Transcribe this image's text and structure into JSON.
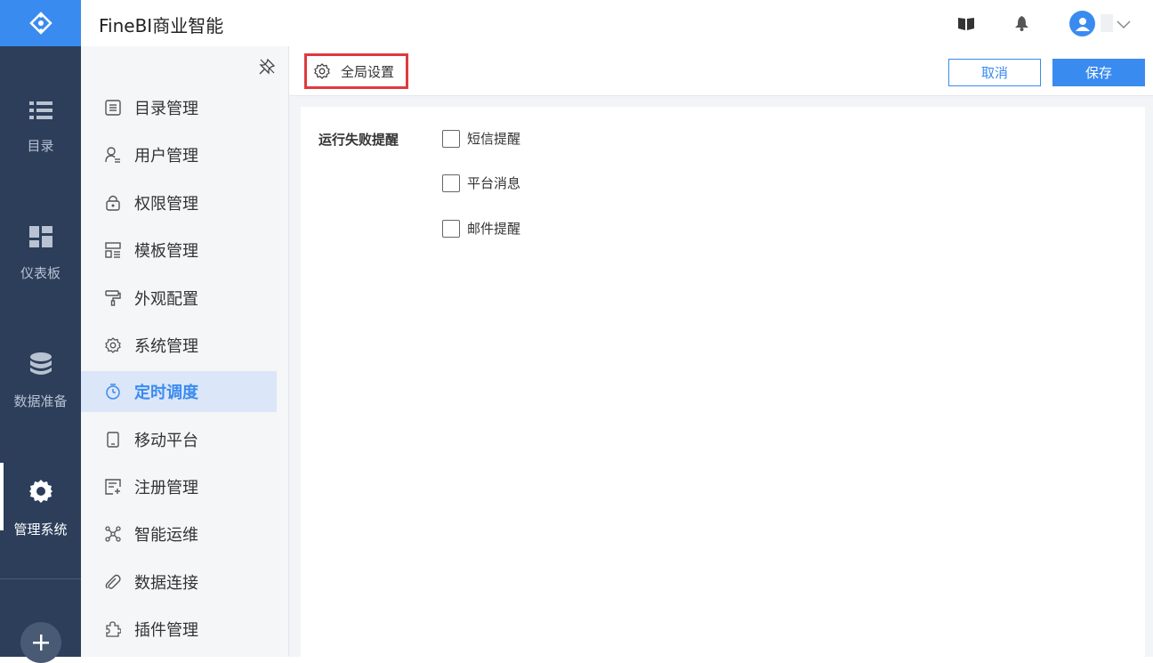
{
  "app": {
    "title": "FineBI商业智能"
  },
  "rail": {
    "items": [
      {
        "label": "目录",
        "icon": "list-icon"
      },
      {
        "label": "仪表板",
        "icon": "dashboard-icon"
      },
      {
        "label": "数据准备",
        "icon": "database-icon"
      },
      {
        "label": "管理系统",
        "icon": "gear-icon",
        "active": true
      }
    ],
    "add_icon": "plus-icon"
  },
  "header": {
    "icons": [
      "book-icon",
      "bell-icon",
      "user-avatar-icon",
      "chevron-down-icon"
    ]
  },
  "subnav": {
    "items": [
      {
        "label": "目录管理",
        "icon": "catalog-icon"
      },
      {
        "label": "用户管理",
        "icon": "user-icon"
      },
      {
        "label": "权限管理",
        "icon": "lock-icon"
      },
      {
        "label": "模板管理",
        "icon": "template-icon"
      },
      {
        "label": "外观配置",
        "icon": "paint-roller-icon"
      },
      {
        "label": "系统管理",
        "icon": "gear-icon"
      },
      {
        "label": "定时调度",
        "icon": "timer-icon",
        "active": true
      },
      {
        "label": "移动平台",
        "icon": "mobile-icon"
      },
      {
        "label": "注册管理",
        "icon": "register-icon"
      },
      {
        "label": "智能运维",
        "icon": "network-icon"
      },
      {
        "label": "数据连接",
        "icon": "paperclip-icon"
      },
      {
        "label": "插件管理",
        "icon": "puzzle-icon"
      }
    ]
  },
  "toolbar": {
    "global_settings_label": "全局设置",
    "cancel_label": "取消",
    "save_label": "保存"
  },
  "settings": {
    "failure_alert_label": "运行失败提醒",
    "options": [
      {
        "label": "短信提醒",
        "checked": false
      },
      {
        "label": "平台消息",
        "checked": false
      },
      {
        "label": "邮件提醒",
        "checked": false
      }
    ]
  },
  "colors": {
    "accent": "#3a8bf0",
    "rail": "#2c3e5a",
    "highlight_border": "#e0393e"
  }
}
